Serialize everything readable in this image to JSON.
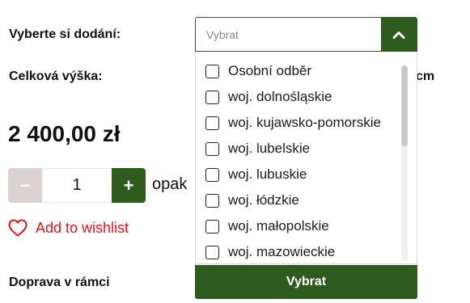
{
  "form": {
    "delivery_label": "Vyberte si dodání:",
    "height_label": "Celková výška:",
    "height_unit": "cm"
  },
  "product": {
    "price": "2 400,00 zł",
    "quantity": "1",
    "quantity_unit": "opak",
    "minus_symbol": "−",
    "plus_symbol": "+"
  },
  "wishlist": {
    "label": "Add to wishlist",
    "icon": "heart-icon",
    "color": "#e3121a"
  },
  "shipping": {
    "label": "Doprava v rámci"
  },
  "delivery_select": {
    "placeholder": "Vybrat",
    "toggle_icon": "chevron-up-icon",
    "accent_color": "#2e5b1e",
    "options": [
      {
        "label": "Osobní odběr",
        "checked": false
      },
      {
        "label": "woj. dolnośląskie",
        "checked": false
      },
      {
        "label": "woj. kujawsko-pomorskie",
        "checked": false
      },
      {
        "label": "woj. lubelskie",
        "checked": false
      },
      {
        "label": "woj. lubuskie",
        "checked": false
      },
      {
        "label": "woj. łódzkie",
        "checked": false
      },
      {
        "label": "woj. małopolskie",
        "checked": false
      },
      {
        "label": "woj. mazowieckie",
        "checked": false
      }
    ],
    "confirm_label": "Vybrat"
  }
}
